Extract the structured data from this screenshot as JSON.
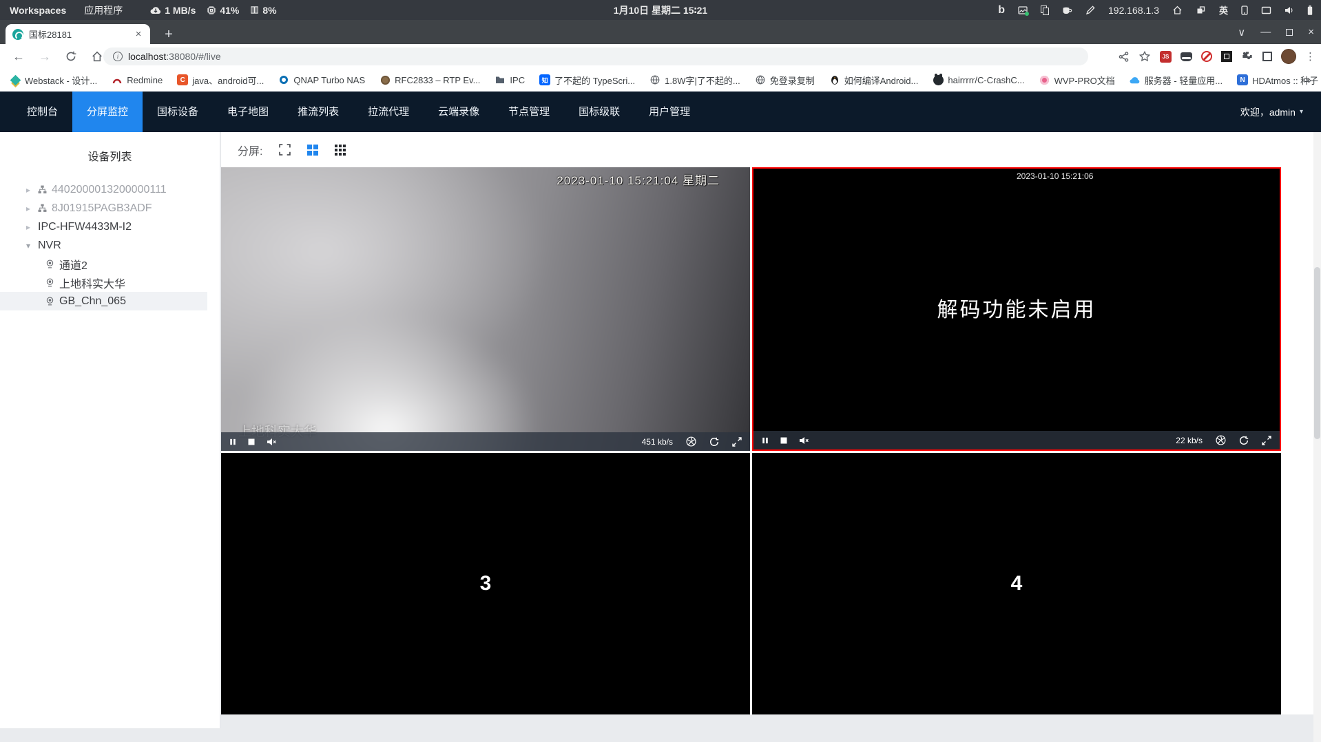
{
  "system_bar": {
    "workspaces": "Workspaces",
    "applications_menu": "应用程序",
    "net_speed": "1 MB/s",
    "cpu_usage": "41%",
    "mem_usage": "8%",
    "clock": "1月10日 星期二 15∶21",
    "bing_logo": "b",
    "ip_address": "192.168.1.3",
    "input_method": "英"
  },
  "browser": {
    "tab_title": "国标28181",
    "address": {
      "host": "localhost",
      "rest": ":38080/#/live"
    },
    "extensions": {
      "js_badge": "JS"
    },
    "bookmarks": [
      {
        "label": "Webstack - 设计..."
      },
      {
        "label": "Redmine"
      },
      {
        "label": "java、android可...",
        "icon_text": "C"
      },
      {
        "label": "QNAP Turbo NAS"
      },
      {
        "label": "RFC2833 – RTP Ev..."
      },
      {
        "label": "IPC"
      },
      {
        "label": "了不起的 TypeScri...",
        "icon_text": "知"
      },
      {
        "label": "1.8W字|了不起的..."
      },
      {
        "label": "免登录复制"
      },
      {
        "label": "如何编译Android..."
      },
      {
        "label": "hairrrrr/C-CrashC..."
      },
      {
        "label": "WVP-PRO文档"
      },
      {
        "label": "服务器 - 轻量应用..."
      },
      {
        "label": "HDAtmos :: 种子 *...",
        "icon_text": "N"
      }
    ],
    "overflow": "»"
  },
  "app": {
    "nav_items": [
      {
        "label": "控制台"
      },
      {
        "label": "分屏监控"
      },
      {
        "label": "国标设备"
      },
      {
        "label": "电子地图"
      },
      {
        "label": "推流列表"
      },
      {
        "label": "拉流代理"
      },
      {
        "label": "云端录像"
      },
      {
        "label": "节点管理"
      },
      {
        "label": "国标级联"
      },
      {
        "label": "用户管理"
      }
    ],
    "user_menu": "欢迎，admin",
    "sidebar": {
      "title": "设备列表",
      "tree": [
        {
          "label": "4402000013200000111"
        },
        {
          "label": "8J01915PAGB3ADF"
        },
        {
          "label": "IPC-HFW4433M-I2"
        },
        {
          "label": "NVR"
        },
        {
          "label": "通道2"
        },
        {
          "label": "上地科实大华"
        },
        {
          "label": "GB_Chn_065"
        }
      ]
    },
    "toolbar": {
      "split_label": "分屏:"
    },
    "players": {
      "p1": {
        "osd_time": "2023-01-10 15:21:04 星期二",
        "watermark": "上地科实大华",
        "bitrate": "451 kb/s"
      },
      "p2": {
        "osd_time": "2023-01-10 15:21:06",
        "message": "解码功能未启用",
        "bitrate": "22 kb/s"
      },
      "p3": {
        "label": "3"
      },
      "p4": {
        "label": "4"
      }
    },
    "colors": {
      "accent_blue": "#2086ee",
      "selected_red": "#ff0000",
      "nav_bg": "#0c1a2a"
    }
  }
}
